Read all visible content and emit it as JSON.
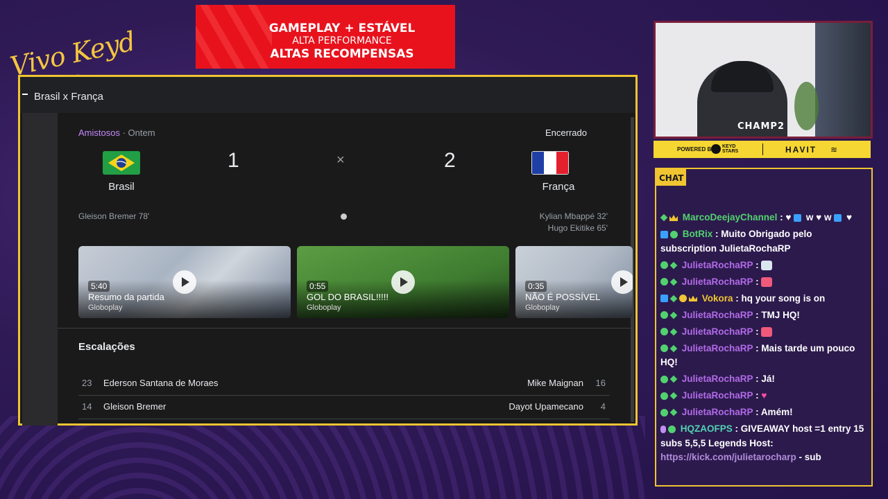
{
  "overlay": {
    "logo_text": "Vivo Keyd Stars",
    "banner": {
      "line1": "GAMEPLAY + ESTÁVEL",
      "line2": "ALTA PERFORMANCE",
      "line3": "ALTAS RECOMPENSAS"
    },
    "sponsor": {
      "powered_by": "POWERED BY",
      "keyd": "KEYD STARS",
      "havit": "HAVIT"
    },
    "cam_logo": "CHAMP2",
    "chat_label": "CHAT"
  },
  "match_panel": {
    "title": "Brasil x França",
    "competition": "Amistosos",
    "separator": " · ",
    "when": "Ontem",
    "status": "Encerrado",
    "home": {
      "name": "Brasil",
      "score": "1",
      "scorers": [
        "Gleison Bremer 78'"
      ]
    },
    "away": {
      "name": "França",
      "score": "2",
      "scorers": [
        "Kylian Mbappé 32'",
        "Hugo Ekitike 65'"
      ]
    },
    "score_separator": "×",
    "videos": [
      {
        "duration": "5:40",
        "title": "Resumo da partida",
        "source": "Globoplay"
      },
      {
        "duration": "0:55",
        "title": "GOL DO BRASIL!!!!!",
        "source": "Globoplay"
      },
      {
        "duration": "0:35",
        "title": "NÃO É POSSÍVEL",
        "source": "Globoplay"
      }
    ],
    "lineups_title": "Escalações",
    "lineups": [
      {
        "home_num": "23",
        "home_name": "Ederson Santana de Moraes",
        "away_name": "Mike Maignan",
        "away_num": "16"
      },
      {
        "home_num": "14",
        "home_name": "Gleison Bremer",
        "away_name": "Dayot Upamecano",
        "away_num": "4"
      }
    ]
  },
  "chat": {
    "messages": [
      {
        "user": "MarcoDeejayChannel",
        "user_color": "#52d26f",
        "text": "w",
        "extra": "w"
      },
      {
        "user": "BotRix",
        "user_color": "#52d26f",
        "text": "Muito Obrigado pelo subscription JulietaRochaRP"
      },
      {
        "user": "JulietaRochaRP",
        "user_color": "#b26be8",
        "text": ""
      },
      {
        "user": "JulietaRochaRP",
        "user_color": "#b26be8",
        "text": ""
      },
      {
        "user": "Vokora",
        "user_color": "#f0c531",
        "text": "hq your song is on"
      },
      {
        "user": "JulietaRochaRP",
        "user_color": "#b26be8",
        "text": "TMJ HQ!"
      },
      {
        "user": "JulietaRochaRP",
        "user_color": "#b26be8",
        "text": ""
      },
      {
        "user": "JulietaRochaRP",
        "user_color": "#b26be8",
        "text": "Mais tarde um pouco HQ!"
      },
      {
        "user": "JulietaRochaRP",
        "user_color": "#b26be8",
        "text": "Já!"
      },
      {
        "user": "JulietaRochaRP",
        "user_color": "#b26be8",
        "text": ""
      },
      {
        "user": "JulietaRochaRP",
        "user_color": "#b26be8",
        "text": "Amém!"
      },
      {
        "user": "HQZAOFPS",
        "user_color": "#52d2b0",
        "text": "GIVEAWAY host =1 entry 15 subs 5,5,5 Legends Host:",
        "link": "https://kick.com/julietarocharp",
        "tail": " - sub"
      }
    ]
  }
}
